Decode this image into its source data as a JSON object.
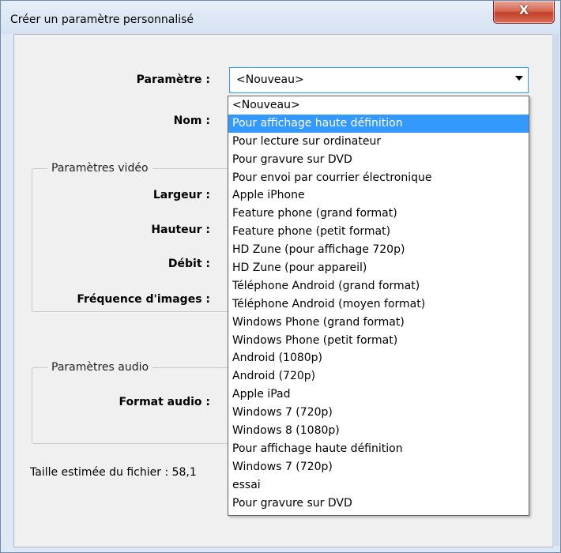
{
  "window": {
    "title": "Créer un paramètre personnalisé",
    "close_glyph": "X"
  },
  "form": {
    "preset_label": "Paramètre :",
    "preset_value": "<Nouveau>",
    "name_label": "Nom :",
    "video_group": "Paramètres vidéo",
    "width_label": "Largeur :",
    "height_label": "Hauteur :",
    "bitrate_label": "Débit :",
    "framerate_label": "Fréquence d'images :",
    "audio_group": "Paramètres audio",
    "audio_format_label": "Format audio :",
    "file_size": "Taille estimée du fichier : 58,1"
  },
  "dropdown": {
    "selected_index": 1,
    "items": [
      "<Nouveau>",
      "Pour affichage haute définition",
      "Pour lecture sur ordinateur",
      "Pour gravure sur DVD",
      "Pour envoi par courrier électronique",
      "Apple iPhone",
      "Feature phone (grand format)",
      "Feature phone (petit format)",
      "HD Zune (pour affichage 720p)",
      "HD Zune (pour appareil)",
      "Téléphone Android (grand format)",
      "Téléphone Android (moyen format)",
      "Windows Phone (grand format)",
      "Windows Phone (petit format)",
      "Android (1080p)",
      "Android (720p)",
      "Apple iPad",
      "Windows 7 (720p)",
      "Windows 8 (1080p)",
      "Pour affichage haute définition",
      "Windows 7 (720p)",
      "essai",
      "Pour gravure sur DVD"
    ]
  },
  "colors": {
    "selection": "#3399ff",
    "close_button": "#c23f26"
  }
}
